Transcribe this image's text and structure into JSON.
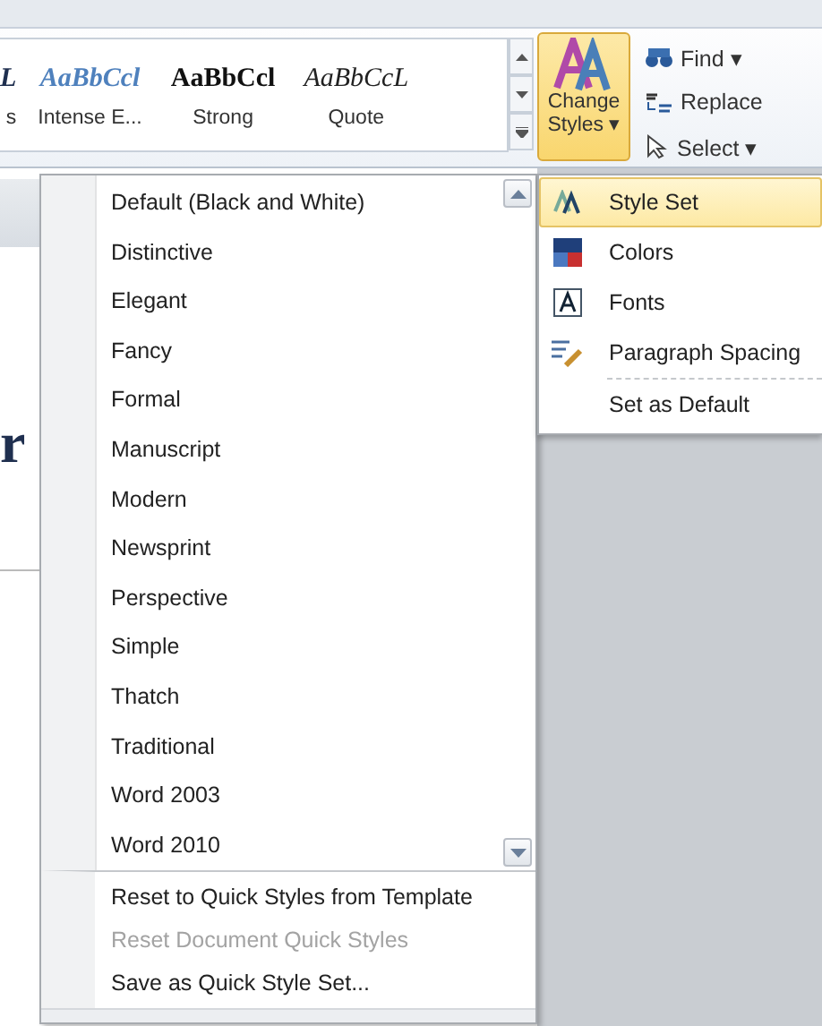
{
  "gallery": {
    "styles": [
      {
        "preview": "L",
        "label": "s",
        "kind": "heading"
      },
      {
        "preview": "AaBbCcl",
        "label": "Intense E...",
        "kind": "intense"
      },
      {
        "preview": "AaBbCcl",
        "label": "Strong",
        "kind": "strong"
      },
      {
        "preview": "AaBbCcL",
        "label": "Quote",
        "kind": "quote"
      }
    ]
  },
  "change_styles": {
    "line1": "Change",
    "line2": "Styles ▾"
  },
  "editing": [
    {
      "label": "Find ▾",
      "kind": "find"
    },
    {
      "label": "Replace",
      "kind": "replace"
    },
    {
      "label": "Select ▾",
      "kind": "select"
    }
  ],
  "document": {
    "heading_fragment": "r"
  },
  "style_sets": {
    "items": [
      {
        "label": "Default (Black and White)"
      },
      {
        "label": "Distinctive"
      },
      {
        "label": "Elegant"
      },
      {
        "label": "Fancy"
      },
      {
        "label": "Formal"
      },
      {
        "label": "Manuscript"
      },
      {
        "label": "Modern"
      },
      {
        "label": "Newsprint"
      },
      {
        "label": "Perspective"
      },
      {
        "label": "Simple"
      },
      {
        "label": "Thatch"
      },
      {
        "label": "Traditional"
      },
      {
        "label": "Word 2003"
      },
      {
        "label": "Word 2010"
      }
    ],
    "footer": [
      {
        "label": "Reset to Quick Styles from Template",
        "disabled": false
      },
      {
        "label": "Reset Document Quick Styles",
        "disabled": true
      },
      {
        "label": "Save as Quick Style Set...",
        "disabled": false
      }
    ]
  },
  "submenu": [
    {
      "label": "Style Set",
      "kind": "styleset",
      "selected": true
    },
    {
      "label": "Colors",
      "kind": "colors",
      "selected": false
    },
    {
      "label": "Fonts",
      "kind": "fonts",
      "selected": false
    },
    {
      "label": "Paragraph Spacing",
      "kind": "spacing",
      "selected": false
    },
    {
      "label": "Set as Default",
      "kind": "default",
      "selected": false
    }
  ]
}
